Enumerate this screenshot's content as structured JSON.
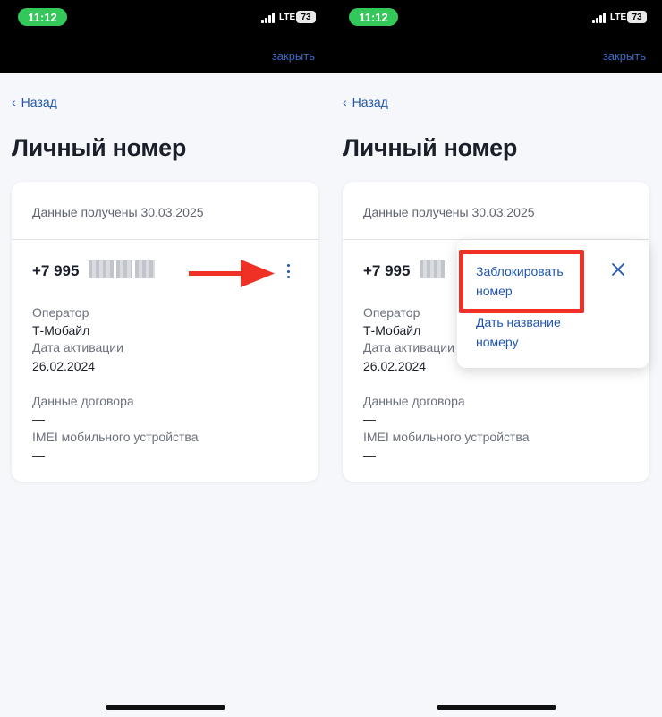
{
  "status": {
    "time": "11:12",
    "network": "LTE",
    "battery": "73"
  },
  "header": {
    "close_label": "закрыть"
  },
  "nav": {
    "back_label": "Назад"
  },
  "page": {
    "title": "Личный номер"
  },
  "card": {
    "received_label": "Данные получены 30.03.2025",
    "phone_prefix": "+7 995",
    "operator_label": "Оператор",
    "operator_value": "Т-Мобайл",
    "activation_label": "Дата активации",
    "activation_value": "26.02.2024",
    "contract_label": "Данные договора",
    "contract_value": "—",
    "imei_label": "IMEI мобильного устройства",
    "imei_value": "—"
  },
  "menu": {
    "items": [
      {
        "label": "Заблокировать номер"
      },
      {
        "label": "Дать название номеру"
      }
    ]
  },
  "colors": {
    "accent": "#1f56b0",
    "highlight": "#ee3124",
    "arrow": "#ee3124",
    "time_pill": "#34c759"
  },
  "icons": {
    "back": "chevron-left-icon",
    "more": "kebab-menu-icon",
    "close": "close-icon",
    "arrow": "arrow-right-icon"
  }
}
